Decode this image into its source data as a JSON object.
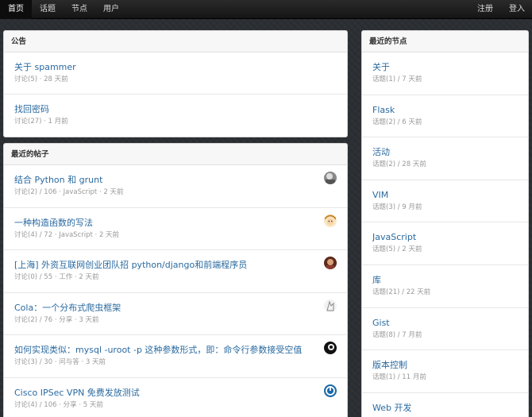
{
  "nav": {
    "home": "首页",
    "topics": "话题",
    "nodes": "节点",
    "users": "用户",
    "register": "注册",
    "login": "登入"
  },
  "announcements": {
    "title": "公告",
    "items": [
      {
        "title": "关于 spammer",
        "meta": "讨论(5) · 28 天前"
      },
      {
        "title": "找回密码",
        "meta": "讨论(27) · 1 月前"
      }
    ]
  },
  "recent_posts": {
    "title": "最近的帖子",
    "items": [
      {
        "title": "结合 Python 和 grunt",
        "meta": "讨论(2) / 106 · JavaScript · 2 天前",
        "avatar": "gray-user"
      },
      {
        "title": "一种构造函数的写法",
        "meta": "讨论(4) / 72 · JavaScript · 2 天前",
        "avatar": "blonde-user"
      },
      {
        "title": "[上海] 外资互联网创业团队招 python/django和前端程序员",
        "meta": "讨论(0) / 55 · 工作 · 2 天前",
        "avatar": "photo-user"
      },
      {
        "title": "Cola：一个分布式爬虫框架",
        "meta": "讨论(2) / 76 · 分享 · 3 天前",
        "avatar": "sketch-user"
      },
      {
        "title": "如何实现类似：mysql -uroot -p 这种参数形式，即：命令行参数接受空值",
        "meta": "讨论(3) / 30 · 问与答 · 3 天前",
        "avatar": "dark-user"
      },
      {
        "title": "Cisco IPSec VPN 免费发放测试",
        "meta": "讨论(4) / 106 · 分享 · 5 天前",
        "avatar": "power-user"
      }
    ]
  },
  "recent_nodes": {
    "title": "最近的节点",
    "items": [
      {
        "title": "关于",
        "meta": "话题(1) / 7 天前"
      },
      {
        "title": "Flask",
        "meta": "话题(2) / 6 天前"
      },
      {
        "title": "活动",
        "meta": "话题(2) / 28 天前"
      },
      {
        "title": "VIM",
        "meta": "话题(3) / 9 月前"
      },
      {
        "title": "JavaScript",
        "meta": "话题(5) / 2 天前"
      },
      {
        "title": "库",
        "meta": "话题(21) / 22 天前"
      },
      {
        "title": "Gist",
        "meta": "话题(8) / 7 月前"
      },
      {
        "title": "版本控制",
        "meta": "话题(1) / 11 月前"
      },
      {
        "title": "Web 开发",
        "meta": ""
      }
    ]
  },
  "colors": {
    "link": "#2a6aa0",
    "navbar": "#1c1c1c",
    "meta": "#999999"
  }
}
